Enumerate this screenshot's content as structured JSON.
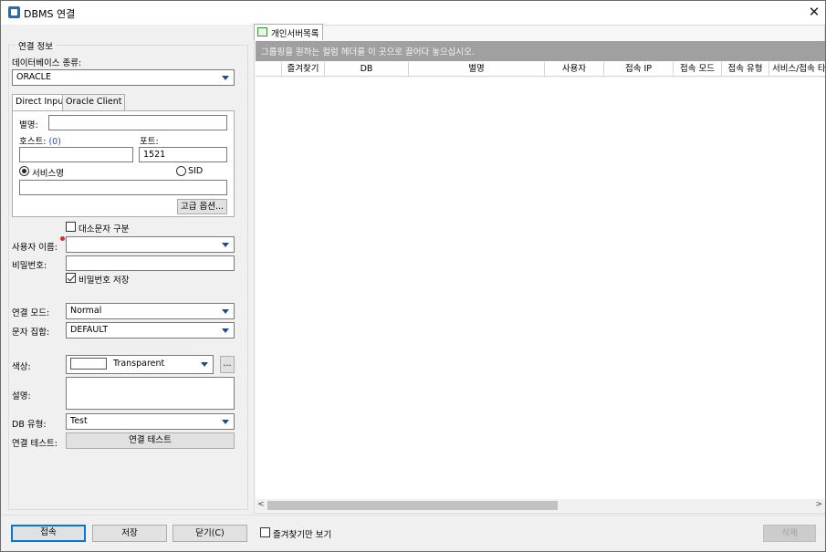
{
  "window": {
    "title": "DBMS 연결",
    "close_glyph": "✕",
    "icon": "app-database-icon"
  },
  "form": {
    "group_title": "연결 정보",
    "db_type_label": "데이터베이스 종류:",
    "db_type_value": "ORACLE",
    "tabs": [
      "Direct Input",
      "Oracle Client"
    ],
    "alias_label": "별명:",
    "alias_value": "",
    "host_label": "호스트:",
    "host_count": "(0)",
    "host_value": "",
    "port_label": "포트:",
    "port_value": "1521",
    "service_name_label": "서비스명",
    "sid_label": "SID",
    "service_value": "",
    "advanced_button": "고급 옵션...",
    "case_sensitive_label": "대소문자 구분",
    "username_label": "사용자 이름:",
    "username_value": "",
    "password_label": "비밀번호:",
    "password_value": "",
    "save_password_label": "비밀번호 저장",
    "conn_mode_label": "연결 모드:",
    "conn_mode_value": "Normal",
    "charset_label": "문자 집합:",
    "charset_value": "DEFAULT",
    "color_label": "색상:",
    "color_value": "Transparent",
    "color_more_button": "...",
    "desc_label": "설명:",
    "desc_value": "",
    "db_kind_label": "DB 유형:",
    "db_kind_value": "Test",
    "conn_test_label": "연결 테스트:",
    "conn_test_button": "연결 테스트"
  },
  "list": {
    "tab_label": "개인서버목록",
    "group_hint": "그룹핑을 원하는 컬럼 헤더를 이 곳으로 끌어다 놓으십시오.",
    "columns": [
      "즐겨찾기",
      "DB",
      "별명",
      "사용자",
      "접속 IP",
      "접속 모드",
      "접속 유형",
      "서비스/접속 타"
    ],
    "scroll_left": "<",
    "scroll_right": ">"
  },
  "footer": {
    "connect_button": "접속",
    "save_button": "저장",
    "close_button": "닫기(C)",
    "favorites_only_label": "즐겨찾기만 보기",
    "delete_button": "삭제"
  },
  "colors": {
    "accent": "#0078d7",
    "required": "#d9312b",
    "group_bar": "#a0a0a0"
  }
}
